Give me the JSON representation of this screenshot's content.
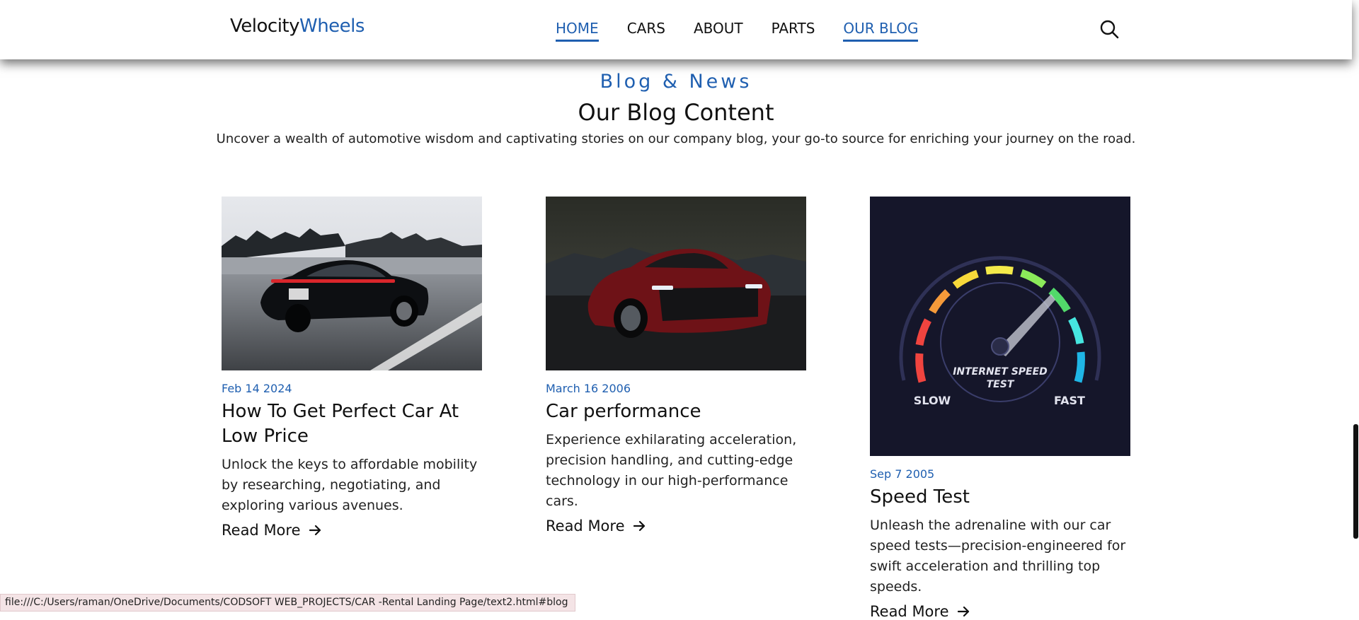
{
  "brand": {
    "part1": "Velocity",
    "part2": "Wheels"
  },
  "nav": {
    "items": [
      {
        "label": "HOME",
        "active": true
      },
      {
        "label": "CARS",
        "active": false
      },
      {
        "label": "ABOUT",
        "active": false
      },
      {
        "label": "PARTS",
        "active": false
      },
      {
        "label": "OUR BLOG",
        "active": true
      }
    ]
  },
  "section": {
    "tag": "Blog & News",
    "title": "Our Blog Content",
    "description": "Uncover a wealth of automotive wisdom and captivating stories on our company blog, your go-to source for enriching your journey on the road."
  },
  "posts": [
    {
      "date": "Feb 14 2024",
      "title": "How To Get Perfect Car At Low Price",
      "text": "Unlock the keys to affordable mobility by researching, negotiating, and exploring various avenues.",
      "read_more": "Read More",
      "image": "black-sports-sedan-on-highway"
    },
    {
      "date": "March 16 2006",
      "title": "Car performance",
      "text": "Experience exhilarating acceleration, precision handling, and cutting-edge technology in our high-performance cars.",
      "read_more": "Read More",
      "image": "red-sports-car-at-dusk"
    },
    {
      "date": "Sep 7 2005",
      "title": "Speed Test",
      "text": "Unleash the adrenaline with our car speed tests—precision-engineered for swift acceleration and thrilling top speeds.",
      "read_more": "Read More",
      "image": "speedometer-graphic",
      "gauge": {
        "caption": "INTERNET SPEED TEST",
        "slow": "SLOW",
        "fast": "FAST"
      }
    }
  ],
  "status_bar": {
    "url": "file:///C:/Users/raman/OneDrive/Documents/CODSOFT WEB_PROJECTS/CAR -Rental Landing Page/text2.html#blog"
  },
  "colors": {
    "accent": "#1f5fb0",
    "gauge_bg": "#15162a"
  },
  "icons": {
    "search": "search-icon",
    "read_more": "arrow-right-icon"
  }
}
